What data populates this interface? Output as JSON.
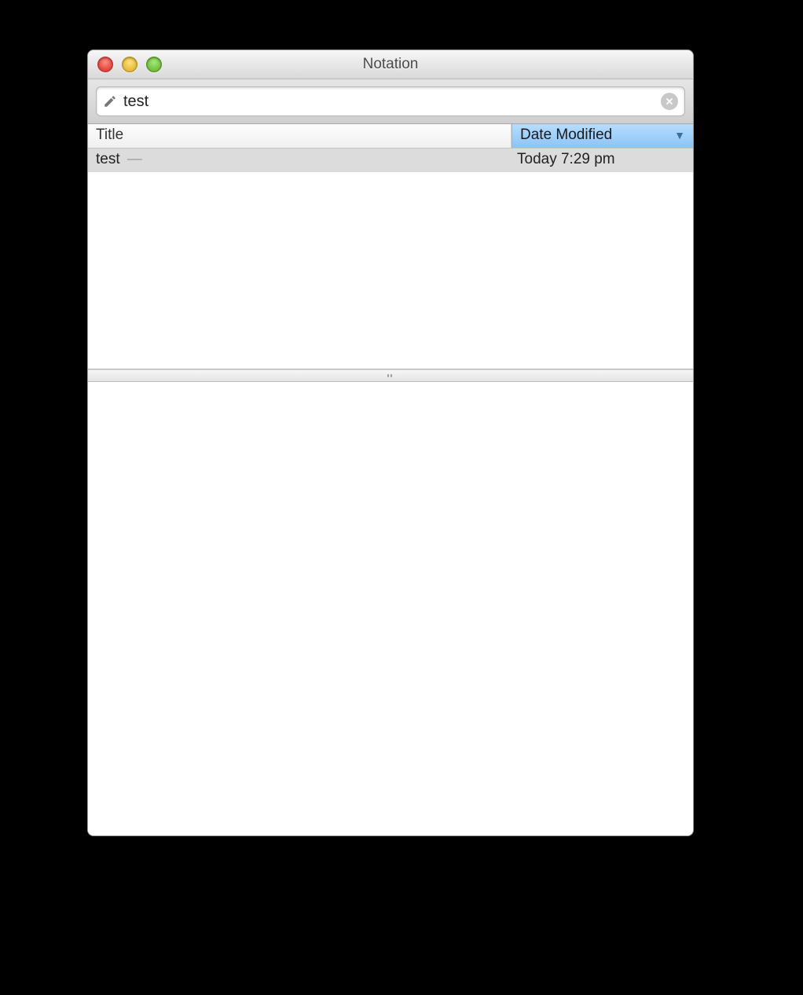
{
  "window": {
    "title": "Notation"
  },
  "search": {
    "value": "test"
  },
  "columns": {
    "title": "Title",
    "date_modified": "Date Modified"
  },
  "rows": [
    {
      "title": "test",
      "suffix": "—",
      "date_modified": "Today  7:29 pm"
    }
  ]
}
